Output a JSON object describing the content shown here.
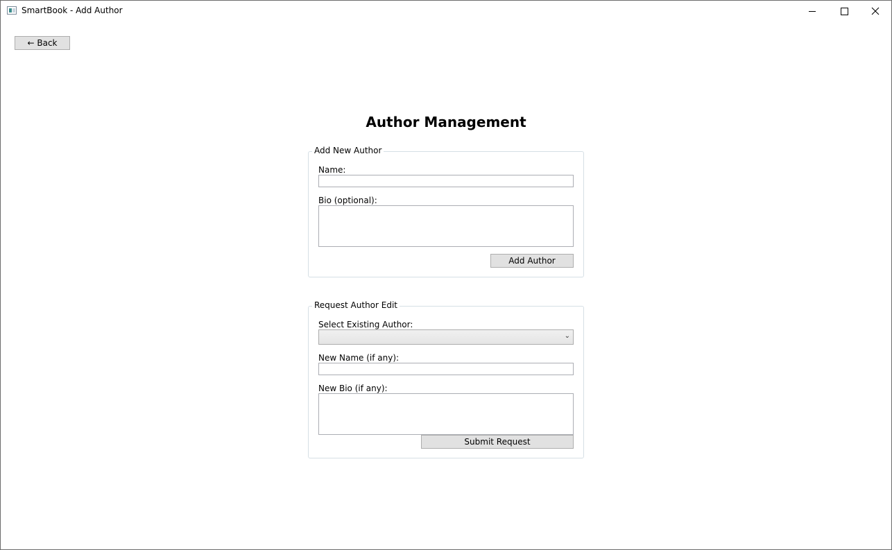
{
  "window": {
    "title": "SmartBook - Add Author",
    "icon": "app-window-icon"
  },
  "nav": {
    "back_label": "← Back"
  },
  "page": {
    "title": "Author Management"
  },
  "add_author": {
    "group_title": "Add New Author",
    "name_label": "Name:",
    "name_value": "",
    "bio_label": "Bio (optional):",
    "bio_value": "",
    "submit_label": "Add Author"
  },
  "edit_request": {
    "group_title": "Request Author Edit",
    "select_label": "Select Existing Author:",
    "selected_author": "",
    "new_name_label": "New Name (if any):",
    "new_name_value": "",
    "new_bio_label": "New Bio (if any):",
    "new_bio_value": "",
    "submit_label": "Submit Request"
  }
}
